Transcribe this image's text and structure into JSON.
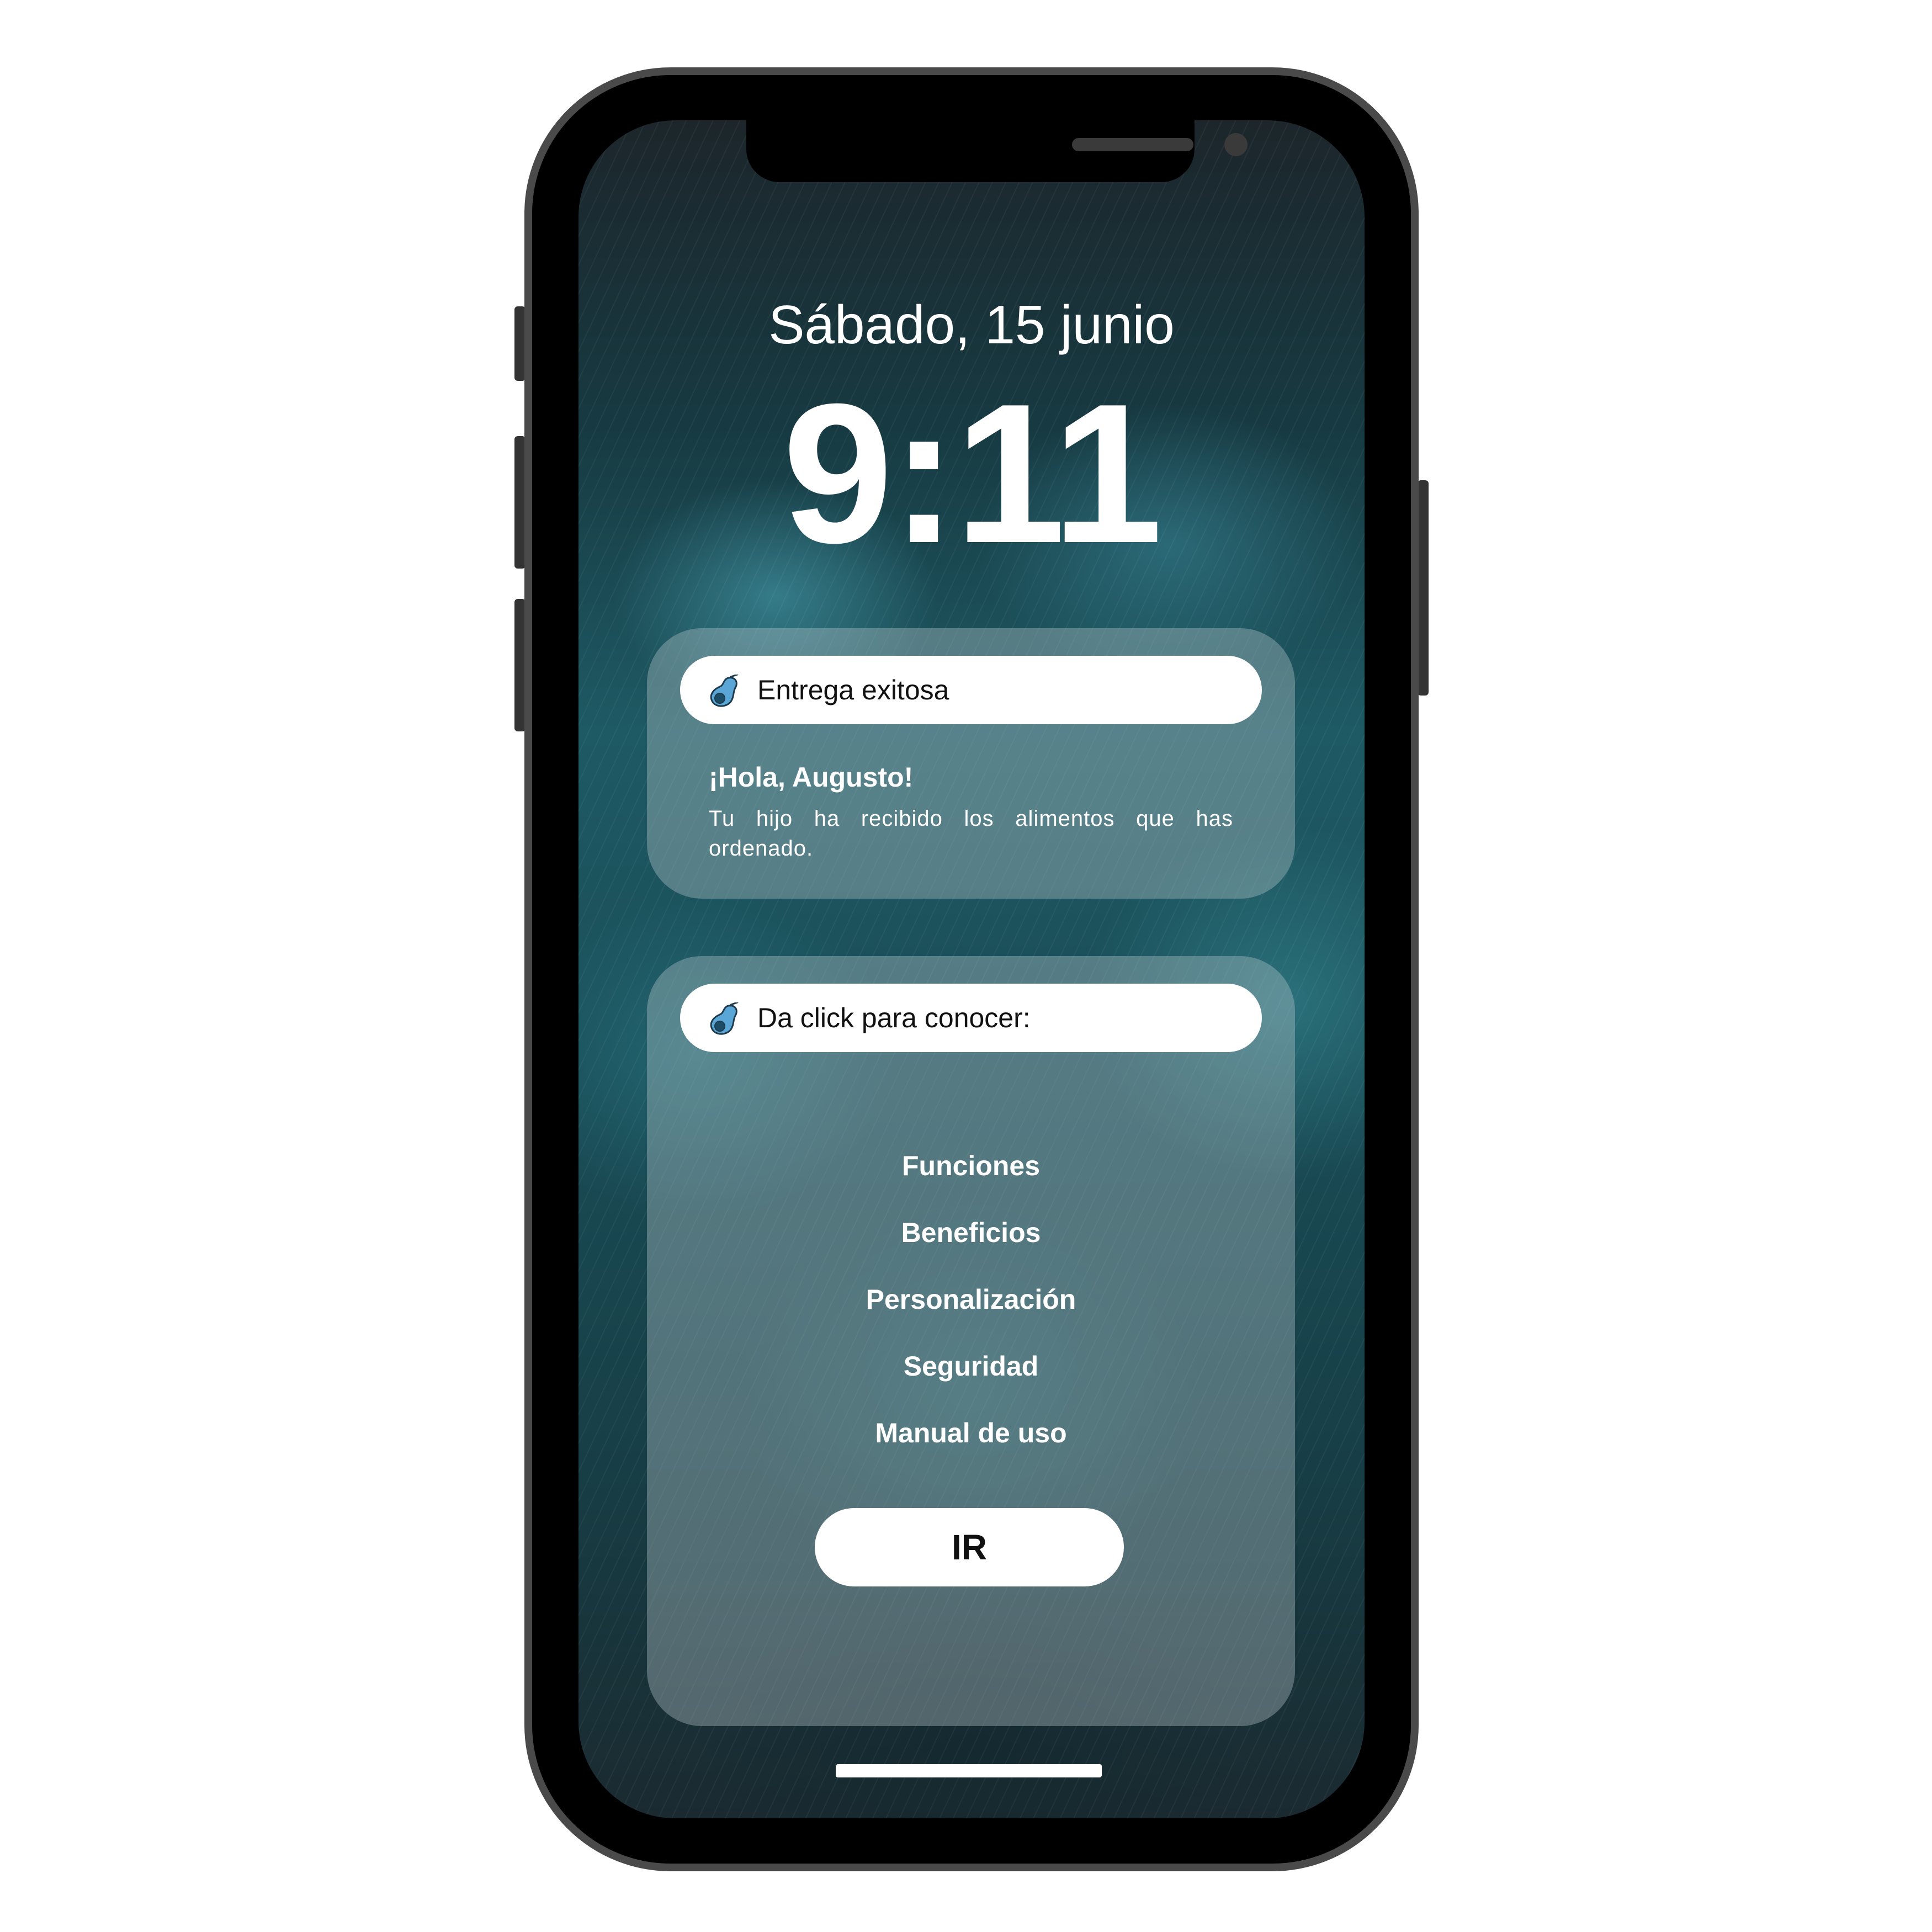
{
  "lock_screen": {
    "date": "Sábado, 15 junio",
    "time": "9:11"
  },
  "notification": {
    "app_icon": "avocado-icon",
    "title": "Entrega exitosa",
    "greeting": "¡Hola, Augusto!",
    "message": "Tu hijo ha recibido los alimentos que has ordenado."
  },
  "info_card": {
    "app_icon": "avocado-icon",
    "title": "Da click para conocer:",
    "items": [
      {
        "label": "Funciones"
      },
      {
        "label": "Beneficios"
      },
      {
        "label": "Personalización"
      },
      {
        "label": "Seguridad"
      },
      {
        "label": "Manual de uso"
      }
    ],
    "button_label": "IR"
  },
  "colors": {
    "phone_frame": "#4a4a4a",
    "card_header": "#ffffff",
    "icon_accent": "#5aa6d6"
  }
}
